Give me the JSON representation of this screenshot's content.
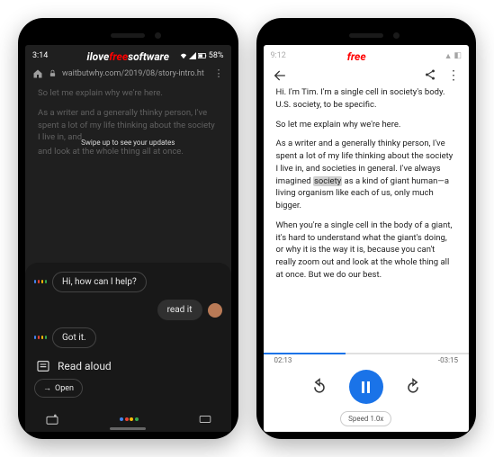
{
  "watermark": {
    "left": "ilove",
    "mid": "free",
    "right": "software"
  },
  "left": {
    "status": {
      "time": "3:14",
      "battery": "58%"
    },
    "url": "waitbutwhy.com/2019/08/story-intro.ht",
    "dimmed": {
      "p1": "So let me explain why we're here.",
      "p2": "As a writer and a generally thinky person, I've spent a lot of my life thinking about the society I live in, and",
      "p3": "and look at the whole thing all at once."
    },
    "swipe_hint": "Swipe up to see your updates",
    "assistant": {
      "greeting": "Hi, how can I help?",
      "user_msg": "read it",
      "confirm": "Got it.",
      "read_aloud_label": "Read aloud",
      "open_label": "Open"
    }
  },
  "right": {
    "article": {
      "p1": "Hi. I'm Tim. I'm a single cell in society's body. U.S. society, to be specific.",
      "p2": "So let me explain why we're here.",
      "p3a": "As a writer and a generally thinky person, I've spent a lot of my life thinking about the society I live in, and societies in general. I've always imagined ",
      "highlight": "society",
      "p3b": " as a kind of giant human—a living organism like each of us, only much bigger.",
      "p4": "When you're a single cell in the body of a giant, it's hard to understand what the giant's doing, or why it is the way it is, because you can't really zoom out and look at the whole thing all at once. But we do our best."
    },
    "player": {
      "elapsed": "02:13",
      "remaining": "-03:15",
      "speed": "Speed 1.0x",
      "progress_pct": 40
    }
  }
}
